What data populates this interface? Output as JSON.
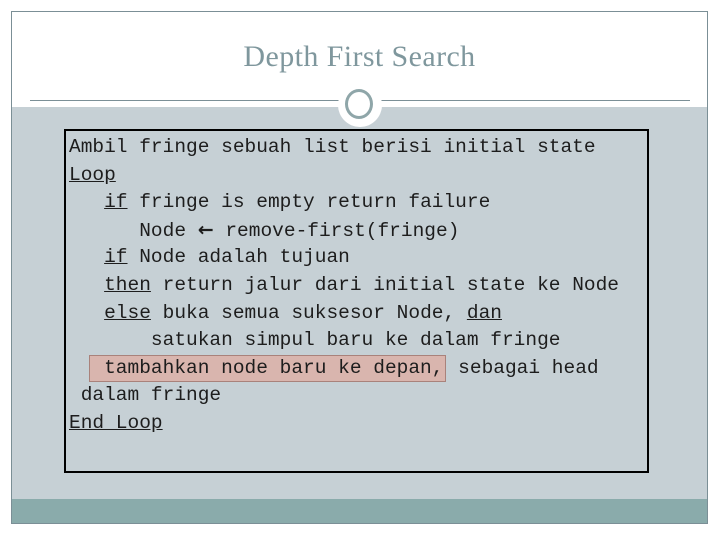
{
  "slide": {
    "title": "Depth First Search",
    "ornament_icon": "circle-ornament-icon",
    "colors": {
      "title_text": "#7f979d",
      "body_background": "#c6d0d5",
      "footer_bar": "#8aabab",
      "frame_line": "#7b8f96",
      "code_border": "#000000",
      "highlight_fill": "#d9b5ae",
      "highlight_border": "#a9827b"
    }
  },
  "code": {
    "lines": [
      {
        "id": "line-1",
        "segments": [
          {
            "text": "Ambil fringe sebuah list berisi initial state",
            "style": "plain"
          }
        ]
      },
      {
        "id": "line-2",
        "segments": [
          {
            "text": "Loop",
            "style": "keyword"
          }
        ]
      },
      {
        "id": "line-3",
        "segments": [
          {
            "text": "   ",
            "style": "plain"
          },
          {
            "text": "if",
            "style": "keyword"
          },
          {
            "text": " fringe is empty return failure",
            "style": "plain"
          }
        ]
      },
      {
        "id": "line-4",
        "segments": [
          {
            "text": "      Node ",
            "style": "plain"
          },
          {
            "text": "←",
            "style": "arrow"
          },
          {
            "text": " remove-first(fringe)",
            "style": "plain"
          }
        ]
      },
      {
        "id": "line-5",
        "segments": [
          {
            "text": "   ",
            "style": "plain"
          },
          {
            "text": "if",
            "style": "keyword"
          },
          {
            "text": " Node adalah tujuan",
            "style": "plain"
          }
        ]
      },
      {
        "id": "line-6",
        "segments": [
          {
            "text": "   ",
            "style": "plain"
          },
          {
            "text": "then",
            "style": "keyword"
          },
          {
            "text": " return jalur dari initial state ke Node",
            "style": "plain"
          }
        ]
      },
      {
        "id": "line-7",
        "segments": [
          {
            "text": "   ",
            "style": "plain"
          },
          {
            "text": "else",
            "style": "keyword"
          },
          {
            "text": " buka semua suksesor Node, ",
            "style": "plain"
          },
          {
            "text": "dan",
            "style": "keyword"
          }
        ]
      },
      {
        "id": "line-8",
        "segments": [
          {
            "text": "       satukan simpul baru ke dalam fringe",
            "style": "plain"
          }
        ]
      },
      {
        "id": "line-9",
        "segments": [
          {
            "text": "  ",
            "style": "plain"
          },
          {
            "text": " tambahkan node baru ke depan,",
            "style": "highlight"
          },
          {
            "text": " sebagai head",
            "style": "plain"
          }
        ]
      },
      {
        "id": "line-10",
        "segments": [
          {
            "text": " dalam fringe",
            "style": "plain"
          }
        ]
      },
      {
        "id": "line-11",
        "segments": [
          {
            "text": "End Loop",
            "style": "keyword"
          }
        ]
      }
    ]
  }
}
